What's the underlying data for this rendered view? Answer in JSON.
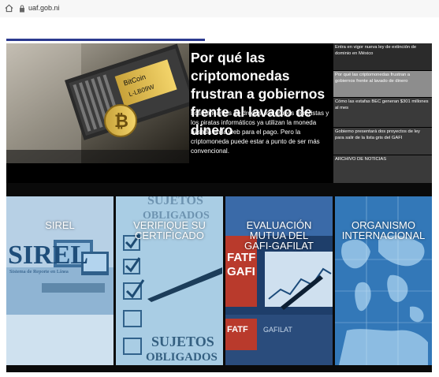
{
  "browser": {
    "url": "uaf.gob.ni",
    "icons": [
      "home-icon",
      "lock-icon"
    ]
  },
  "hero": {
    "title": "Por qué las criptomonedas frustran a gobiernos frente al lavado de dinero",
    "text": "Los traficantes de drogas, los grupos terroristas y los piratas informáticos ya utilizan la moneda basada en la web para el pago. Pero la criptomoneda puede estar a punto de ser más convencional.",
    "image_text": [
      "BitCoin",
      "L-LB09W"
    ]
  },
  "news": [
    "Entra en vigor nueva ley de extinción de dominio en México",
    "Por qué las criptomonedas frustran a gobiernos frente al lavado de dinero",
    "Cómo las estafas BEC generan $301 millones al mes",
    "Gobierno presentará dos proyectos de ley para salir de la lista gris del GAFI",
    "ARCHIVO DE NOTICIAS"
  ],
  "tiles": [
    {
      "line1": "SIREL",
      "line2": "",
      "image_text": [
        "SIREL",
        "Sistema de Reporte en Línea"
      ]
    },
    {
      "line1": "VERIFIQUE SU",
      "line2": "CERTIFICADO",
      "image_text": [
        "SUJETOS",
        "OBLIGADOS",
        "SUJETOS",
        "OBLIGADOS"
      ]
    },
    {
      "line1": "EVALUACIÓN",
      "line2": "MUTUA DEL",
      "line3": "GAFI-GAFILAT",
      "image_text": [
        "FATF",
        "GAFI",
        "FATF",
        "GAFILAT"
      ]
    },
    {
      "line1": "ORGANISMO",
      "line2": "INTERNACIONAL",
      "image_text": []
    }
  ],
  "colors": {
    "accent_strip": "#2c3a8f",
    "hero_bg": "#000000",
    "news_highlight": "#8d8d8d"
  }
}
